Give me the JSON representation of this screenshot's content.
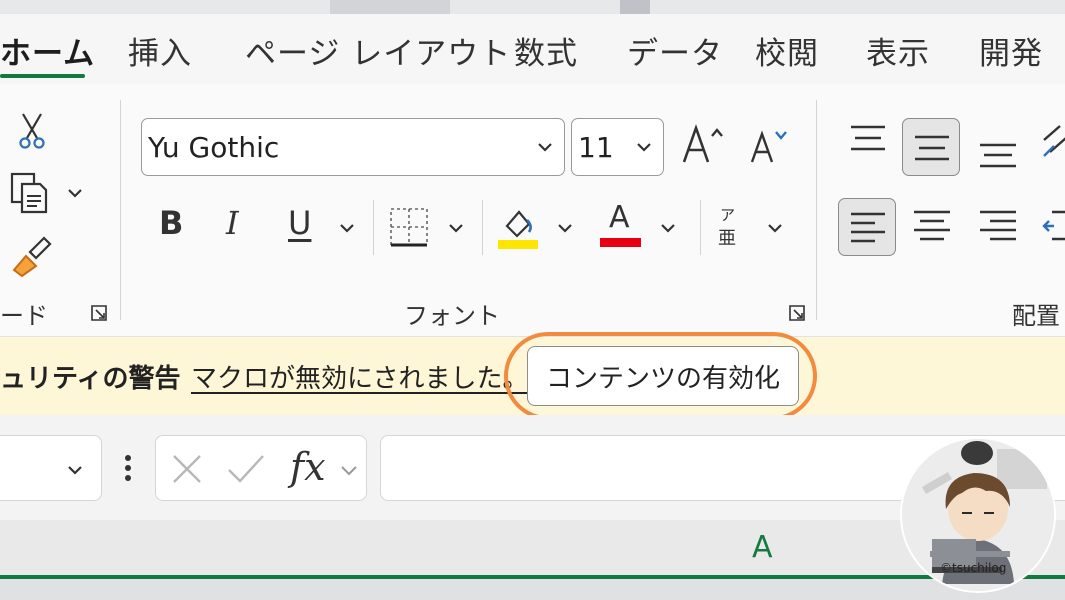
{
  "tabs": [
    {
      "label": "ホーム",
      "active": true
    },
    {
      "label": "挿入"
    },
    {
      "label": "ページ レイアウト"
    },
    {
      "label": "数式"
    },
    {
      "label": "データ"
    },
    {
      "label": "校閲"
    },
    {
      "label": "表示"
    },
    {
      "label": "開発"
    }
  ],
  "ribbon": {
    "clipboard": {
      "label": "ード"
    },
    "font": {
      "label": "フォント",
      "font_name": "Yu Gothic",
      "font_size": "11",
      "bold_label": "B",
      "italic_label": "I",
      "underline_label": "U",
      "font_color_label": "A",
      "highlight_color": "#ffe600",
      "font_color": "#e60012",
      "phonetic_top": "ア",
      "phonetic_bottom": "亜"
    },
    "alignment": {
      "label": "配置"
    }
  },
  "message_bar": {
    "title": "ュリティの警告",
    "text": "マクロが無効にされました。",
    "button_label": "コンテンツの有効化",
    "highlight_color": "#f28a3f"
  },
  "formula_bar": {
    "fx_label": "fx"
  },
  "grid": {
    "column_letter": "A",
    "accent": "#137a3f"
  },
  "avatar": {
    "credit": "©tsuchilog"
  }
}
